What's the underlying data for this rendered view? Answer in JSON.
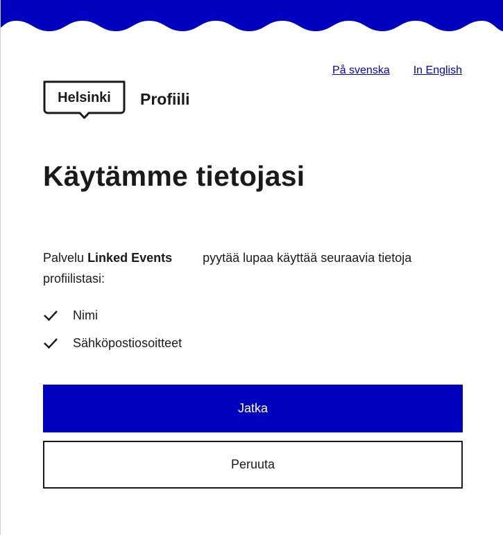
{
  "colors": {
    "brand_blue": "#0000bf",
    "text": "#1a1a1a",
    "background": "#ffffff"
  },
  "header": {
    "decoration": "wave-koro",
    "lang_links": [
      {
        "label": "På svenska"
      },
      {
        "label": "In English"
      }
    ],
    "logo": {
      "text": "Helsinki",
      "icon": "helsinki-logo"
    },
    "service_name": "Profiili"
  },
  "main": {
    "title": "Käytämme tietojasi",
    "intro_prefix": "Palvelu",
    "client_name": "Linked Events",
    "intro_suffix": "pyytää lupaa käyttää seuraavia tietoja profiilistasi:",
    "scopes": [
      {
        "label": "Nimi",
        "icon": "checkmark-icon"
      },
      {
        "label": "Sähköpostiosoitteet",
        "icon": "checkmark-icon"
      }
    ]
  },
  "actions": {
    "continue_label": "Jatka",
    "cancel_label": "Peruuta"
  }
}
